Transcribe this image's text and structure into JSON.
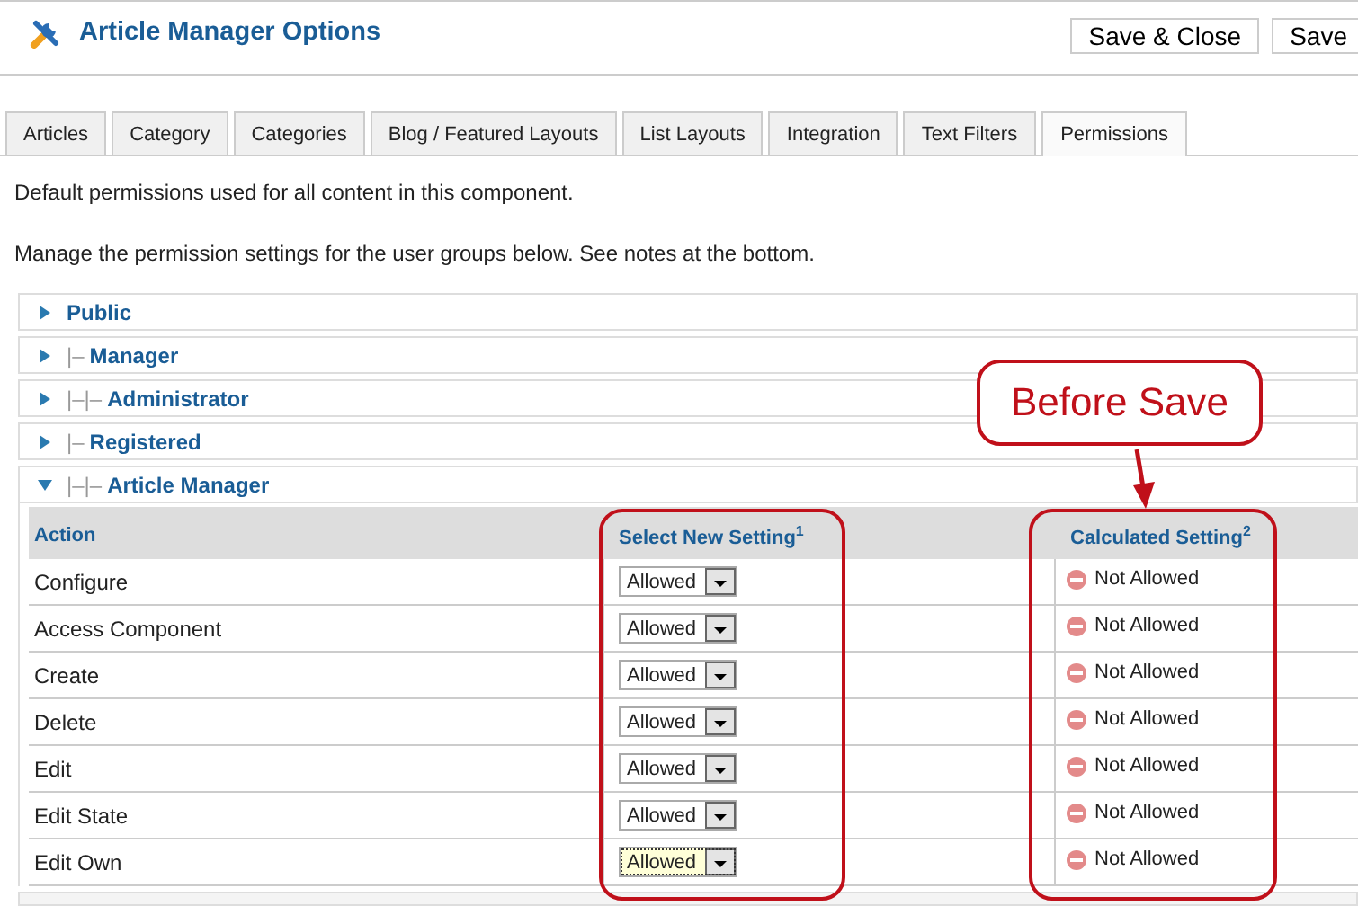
{
  "header": {
    "title": "Article Manager Options",
    "buttons": [
      "Save & Close",
      "Save"
    ]
  },
  "tabs": [
    {
      "label": "Articles",
      "selected": false
    },
    {
      "label": "Category",
      "selected": false
    },
    {
      "label": "Categories",
      "selected": false
    },
    {
      "label": "Blog / Featured Layouts",
      "selected": false
    },
    {
      "label": "List Layouts",
      "selected": false
    },
    {
      "label": "Integration",
      "selected": false
    },
    {
      "label": "Text Filters",
      "selected": false
    },
    {
      "label": "Permissions",
      "selected": true
    }
  ],
  "intro": [
    "Default permissions used for all content in this component.",
    "Manage the permission settings for the user groups below. See notes at the bottom."
  ],
  "groups": [
    {
      "name": "Public",
      "expanded": false
    },
    {
      "prefix": "|–",
      "name": "Manager",
      "expanded": false
    },
    {
      "prefix": "|–|–",
      "name": "Administrator",
      "expanded": false
    },
    {
      "prefix": "|–",
      "name": "Registered",
      "expanded": false
    },
    {
      "prefix": "|–|–",
      "name": "Article Manager",
      "expanded": true
    }
  ],
  "table": {
    "columns": [
      "Action",
      "Select New Setting$^{1}$",
      "Calculated Setting$^{2}$"
    ],
    "rows": [
      {
        "action": "Configure",
        "setting": "Allowed",
        "focused": false,
        "calculated": "Not Allowed"
      },
      {
        "action": "Access Component",
        "setting": "Allowed",
        "focused": false,
        "calculated": "Not Allowed"
      },
      {
        "action": "Create",
        "setting": "Allowed",
        "focused": false,
        "calculated": "Not Allowed"
      },
      {
        "action": "Delete",
        "setting": "Allowed",
        "focused": false,
        "calculated": "Not Allowed"
      },
      {
        "action": "Edit",
        "setting": "Allowed",
        "focused": false,
        "calculated": "Not Allowed"
      },
      {
        "action": "Edit State",
        "setting": "Allowed",
        "focused": false,
        "calculated": "Not Allowed"
      },
      {
        "action": "Edit Own",
        "setting": "Allowed",
        "focused": true,
        "calculated": "Not Allowed"
      }
    ]
  },
  "annotation": {
    "callout": "Before Save"
  }
}
